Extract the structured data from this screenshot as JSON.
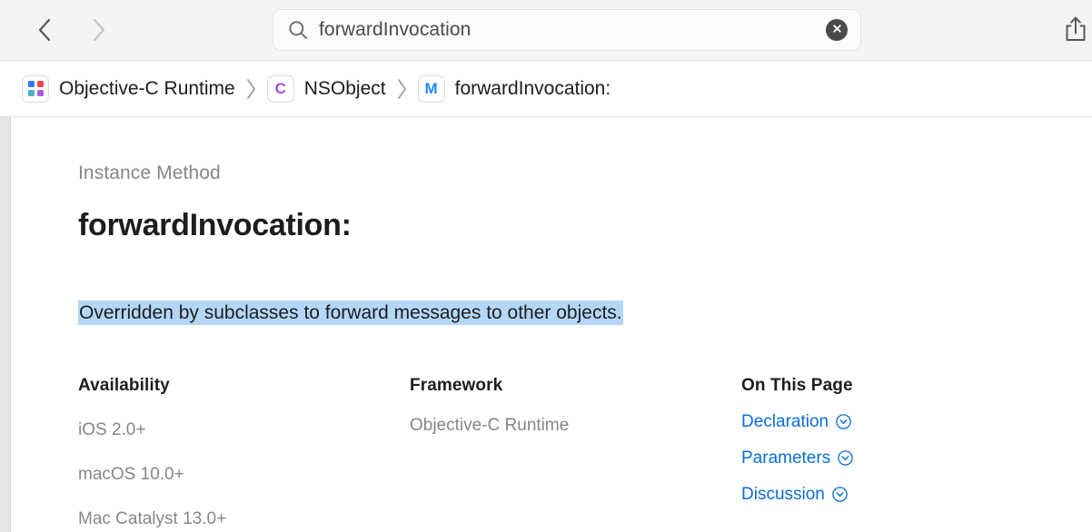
{
  "toolbar": {
    "back_label": "Back",
    "forward_label": "Forward",
    "back_icon": "chevron-left-icon",
    "forward_icon": "chevron-right-icon",
    "share_icon": "share-icon",
    "share_label": "Share"
  },
  "search": {
    "icon": "search-icon",
    "value": "forwardInvocation",
    "placeholder": "Search",
    "clear_icon": "clear-icon",
    "clear_label": "Clear search"
  },
  "breadcrumb": [
    {
      "label": "Objective-C Runtime",
      "badge_type": "framework-grid",
      "badge_text": "",
      "badge_colors": [
        "#3478f6",
        "#f04a50",
        "#49afc4",
        "#a560e8"
      ]
    },
    {
      "label": "NSObject",
      "badge_type": "letter",
      "badge_text": "C",
      "badge_color": "#a24ee0"
    },
    {
      "label": "forwardInvocation:",
      "badge_type": "letter",
      "badge_text": "M",
      "badge_color": "#1f87f5"
    }
  ],
  "breadcrumb_separator": "chevron-right-icon",
  "main": {
    "eyebrow": "Instance Method",
    "title": "forwardInvocation:",
    "abstract": "Overridden by subclasses to forward messages to other objects."
  },
  "availability": {
    "heading": "Availability",
    "items": [
      "iOS 2.0+",
      "macOS 10.0+",
      "Mac Catalyst 13.0+"
    ]
  },
  "framework": {
    "heading": "Framework",
    "value": "Objective-C Runtime"
  },
  "on_this_page": {
    "heading": "On This Page",
    "items": [
      {
        "label": "Declaration",
        "icon": "chevron-down-circle-icon"
      },
      {
        "label": "Parameters",
        "icon": "chevron-down-circle-icon"
      },
      {
        "label": "Discussion",
        "icon": "chevron-down-circle-icon"
      }
    ]
  },
  "colors": {
    "link": "#0a6ed6",
    "selection_highlight": "#b4d7f7",
    "toolbar_background": "#f4f4f4",
    "secondary_text": "#86868b",
    "primary_text": "#1d1d1f"
  }
}
